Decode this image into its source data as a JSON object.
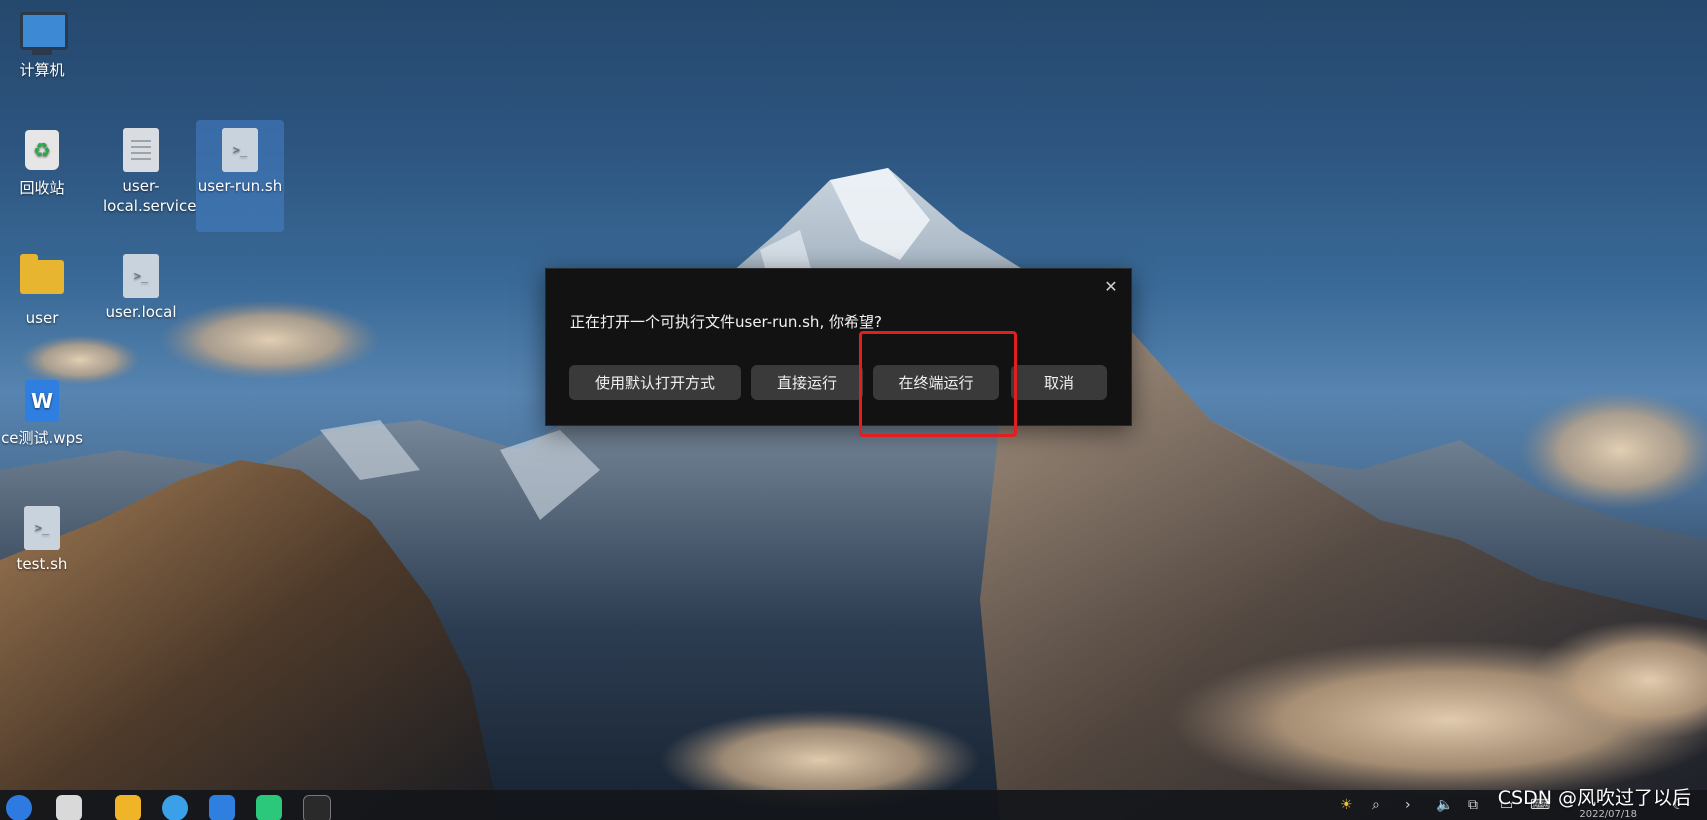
{
  "desktop": {
    "icons": [
      {
        "label": "计算机"
      },
      {
        "label": "回收站"
      },
      {
        "label": "user-local.service"
      },
      {
        "label": "user-run.sh"
      },
      {
        "label": "user"
      },
      {
        "label": "user.local"
      },
      {
        "label": "ce测试.wps"
      },
      {
        "label": "test.sh"
      }
    ]
  },
  "dialog": {
    "message": "正在打开一个可执行文件user-run.sh, 你希望?",
    "close_glyph": "✕",
    "buttons": {
      "default_open": "使用默认打开方式",
      "run_directly": "直接运行",
      "run_in_terminal": "在终端运行",
      "cancel": "取消"
    }
  },
  "highlight": {
    "color": "#e02020"
  },
  "taskbar": {
    "date": "2022/07/18"
  },
  "watermark": "CSDN @风吹过了以后"
}
